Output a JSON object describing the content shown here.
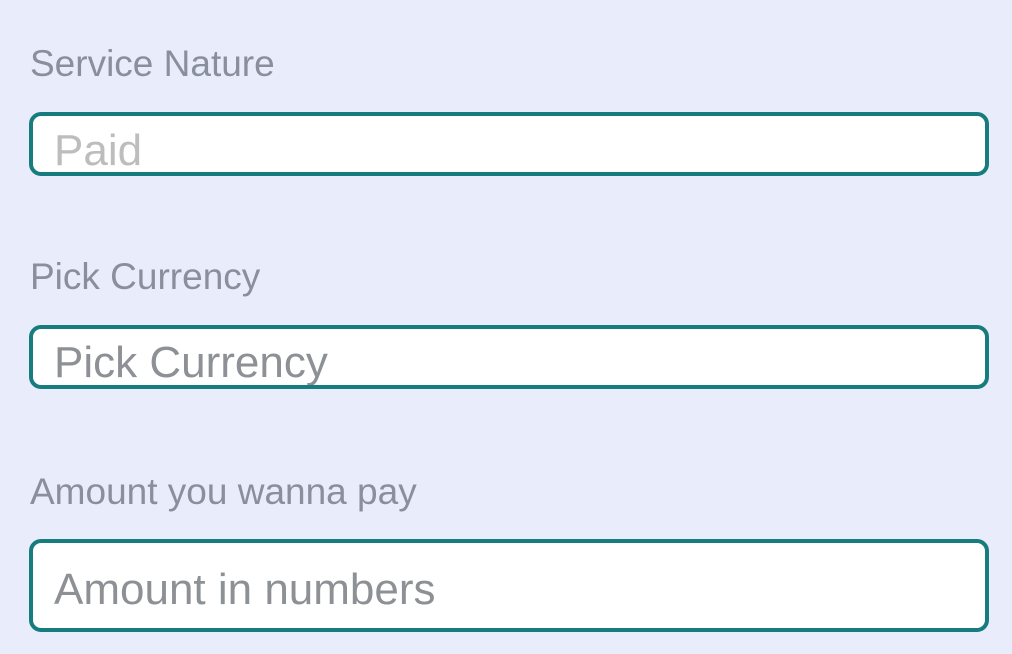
{
  "form": {
    "service_nature": {
      "label": "Service Nature",
      "placeholder": "Paid"
    },
    "currency": {
      "label": "Pick Currency",
      "value": "Pick Currency"
    },
    "amount": {
      "label": "Amount you wanna pay",
      "placeholder": "Amount in numbers"
    }
  },
  "colors": {
    "background": "#E9ECFB",
    "field_border": "#177C7E",
    "label_text": "#8A8F9C",
    "placeholder_text": "#BDBDBD"
  }
}
